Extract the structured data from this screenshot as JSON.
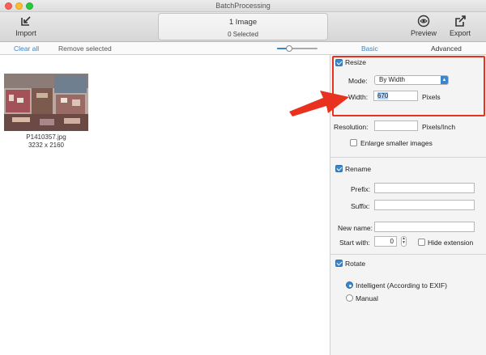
{
  "window": {
    "title": "BatchProcessing"
  },
  "toolbar": {
    "import_label": "Import",
    "preview_label": "Preview",
    "export_label": "Export",
    "status_title": "1 Image",
    "status_subtitle": "0 Selected"
  },
  "subbar": {
    "clear_all": "Clear all",
    "remove_selected": "Remove selected",
    "thumb_size_fraction": 0.3,
    "tabs": [
      {
        "label": "Basic",
        "active": true
      },
      {
        "label": "Advanced",
        "active": false
      }
    ]
  },
  "images": [
    {
      "filename": "P1410357.jpg",
      "dimensions": "3232 x 2160"
    }
  ],
  "resize": {
    "label": "Resize",
    "checked": true,
    "mode_label": "Mode:",
    "mode_value": "By Width",
    "width_label": "Width:",
    "width_value": "670",
    "width_unit": "Pixels",
    "resolution_label": "Resolution:",
    "resolution_value": "",
    "resolution_unit": "Pixels/Inch",
    "enlarge_label": "Enlarge smaller images",
    "enlarge_checked": false
  },
  "rename": {
    "label": "Rename",
    "checked": true,
    "prefix_label": "Prefix:",
    "prefix_value": "",
    "suffix_label": "Suffix:",
    "suffix_value": "",
    "new_name_label": "New name:",
    "new_name_value": "",
    "start_with_label": "Start with:",
    "start_with_value": "0",
    "hide_extension_label": "Hide extension",
    "hide_extension_checked": false
  },
  "rotate": {
    "label": "Rotate",
    "checked": true,
    "options": [
      {
        "label": "Intelligent (According to EXIF)",
        "selected": true
      },
      {
        "label": "Manual",
        "selected": false
      }
    ]
  },
  "colors": {
    "accent": "#3a86c8",
    "annotation": "#e8321f"
  }
}
